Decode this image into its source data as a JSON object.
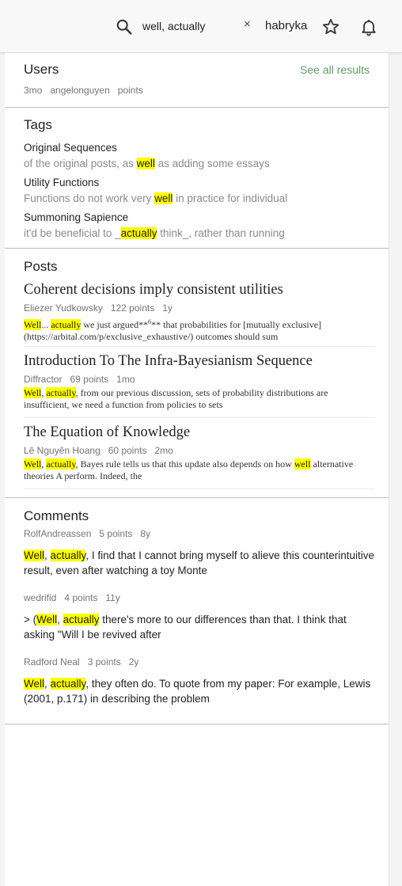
{
  "header": {
    "search_value": "well, actually",
    "clear_symbol": "×",
    "username": "habryka",
    "icons": [
      "search-icon",
      "clear-icon",
      "star-icon",
      "bell-icon"
    ]
  },
  "users": {
    "title": "Users",
    "see_all": "See all results",
    "result": {
      "age": "3mo",
      "name": "angelonguyen",
      "points": "points"
    }
  },
  "tags": {
    "title": "Tags",
    "items": [
      {
        "name": "Original Sequences",
        "before": "of the original posts, as ",
        "hl": "well",
        "after": " as adding some essays"
      },
      {
        "name": "Utility Functions",
        "before": "Functions do not work very ",
        "hl": "well",
        "after": " in practice for individual"
      },
      {
        "name": "Summoning Sapience",
        "before": "it'd be beneficial to _",
        "hl": "actually",
        "after": " think_, rather than running"
      }
    ]
  },
  "posts": {
    "title": "Posts",
    "items": [
      {
        "title": "Coherent decisions imply consistent utilities",
        "author": "Eliezer Yudkowsky",
        "points": "122 points",
        "age": "1y",
        "s1": "Well",
        "s2": "... ",
        "s3": "actually",
        "s4": " we just argued**",
        "s4sup": "6",
        "s5": "** that probabilities for [mutually exclusive](https://arbital.com/p/exclusive_exhaustive/) outcomes should sum"
      },
      {
        "title": "Introduction To The Infra-Bayesianism Sequence",
        "author": "Diffractor",
        "points": "69 points",
        "age": "1mo",
        "s1": "Well",
        "s2": ", ",
        "s3": "actually",
        "s4": ", from our previous discussion, sets of probability distributions are insufficient, we need a function from policies to sets"
      },
      {
        "title": "The Equation of Knowledge",
        "author": "Lê Nguyên Hoang",
        "points": "60 points",
        "age": "2mo",
        "s1": "Well",
        "s2": ", ",
        "s3": "actually",
        "s4": ", Bayes rule tells us that this update also depends on how ",
        "s5": "well",
        "s6": " alternative theories A perform. Indeed, the"
      }
    ]
  },
  "comments": {
    "title": "Comments",
    "items": [
      {
        "author": "RolfAndreassen",
        "points": "5 points",
        "age": "8y",
        "pre": "",
        "w": "Well",
        "sep": ", ",
        "a": "actually",
        "rest": ", I find that I cannot bring myself to alieve this counterintuitive result, even after watching a toy Monte"
      },
      {
        "author": "wedrifid",
        "points": "4 points",
        "age": "11y",
        "pre": "> (",
        "w": "Well",
        "sep": ", ",
        "a": "actually",
        "rest": " there's more to our differences than that. I think that asking \"Will I be revived after"
      },
      {
        "author": "Radford Neal",
        "points": "3 points",
        "age": "2y",
        "pre": "",
        "w": "Well",
        "sep": ", ",
        "a": "actually",
        "rest": ", they often do. To quote from my paper: For example, Lewis (2001, p.171) in describing the problem"
      }
    ]
  }
}
